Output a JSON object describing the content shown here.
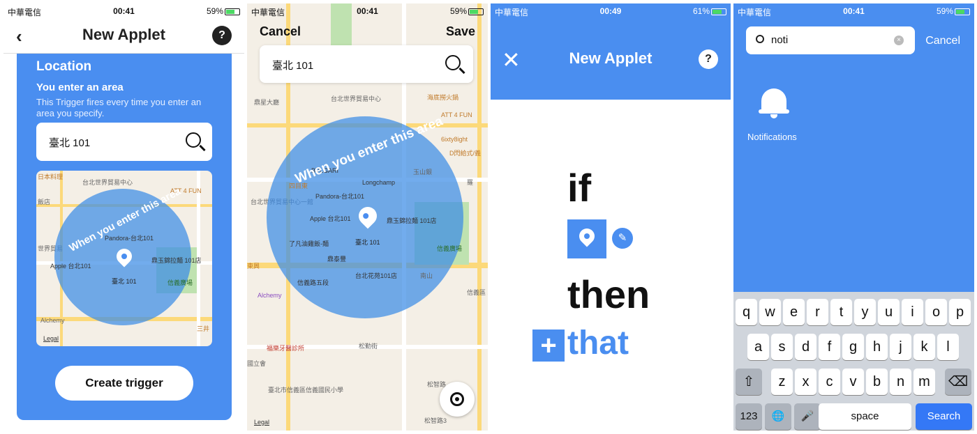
{
  "status": [
    {
      "carrier": "中華電信",
      "time": "00:41",
      "battery": "59%"
    },
    {
      "carrier": "中華電信",
      "time": "00:41",
      "battery": "59%"
    },
    {
      "carrier": "中華電信",
      "time": "00:49",
      "battery": "61%"
    },
    {
      "carrier": "中華電信",
      "time": "00:41",
      "battery": "59%"
    }
  ],
  "panel1": {
    "title": "New Applet",
    "back_icon": "‹",
    "help": "?",
    "section": "Location",
    "trigger_name": "You enter an area",
    "trigger_desc": "This Trigger fires every time you enter an area you specify.",
    "search_value": "臺北 101",
    "arc_text": "When you enter this area",
    "pin_label": "臺北 101",
    "legal": "Legal",
    "button": "Create trigger",
    "poi": [
      "日本料理",
      "台北世界貿易中心",
      "ATT 4 FUN",
      "飯店",
      "Pandora-台北101",
      "鼎玉錦拉麵 101店",
      "Apple 台北101",
      "信義廣場",
      "世界貿易",
      "Alchemy",
      "鼎泰豐",
      "三井",
      "台北101",
      "松",
      "台"
    ]
  },
  "panel2": {
    "cancel": "Cancel",
    "save": "Save",
    "search_value": "臺北 101",
    "arc_text": "When you enter this area",
    "pin_label": "臺北 101",
    "legal": "Legal",
    "poi": [
      "台北世界貿易中心",
      "鼎星大廳",
      "海底撈火鍋",
      "ATT 4 FUN",
      "6ixty8ight",
      "D閃給式/義",
      "BVLGARI",
      "Longchamp",
      "信義廣場",
      "Pandora-台北101",
      "鼎玉錦拉麵 101店",
      "Apple 台北101",
      "了凡油雞飯-麵",
      "鼎泰豐",
      "台北101店",
      "信義路五段",
      "台北花苑101店",
      "Alchemy",
      "國立會",
      "福樂牙醫診所",
      "臺北市信義區信義國民小學",
      "松勤街",
      "松智路",
      "松智路3",
      "四目東",
      "玉山銀",
      "南山",
      "信義區 北市101店",
      "羅",
      "東興",
      "台北世界貿易中心一館"
    ]
  },
  "panel3": {
    "title": "New Applet",
    "close": "✕",
    "help": "?",
    "if": "if",
    "then": "then",
    "that": "that",
    "plus": "+",
    "edit_icon": "✎"
  },
  "panel4": {
    "query": "noti",
    "cancel": "Cancel",
    "result": "Notifications",
    "clear": "×",
    "keys_row1": [
      "q",
      "w",
      "e",
      "r",
      "t",
      "y",
      "u",
      "i",
      "o",
      "p"
    ],
    "keys_row2": [
      "a",
      "s",
      "d",
      "f",
      "g",
      "h",
      "j",
      "k",
      "l"
    ],
    "keys_row3": [
      "z",
      "x",
      "c",
      "v",
      "b",
      "n",
      "m"
    ],
    "shift": "⇧",
    "backspace": "⌫",
    "k123": "123",
    "globe": "🌐",
    "mic": "🎤",
    "space": "space",
    "search": "Search"
  }
}
